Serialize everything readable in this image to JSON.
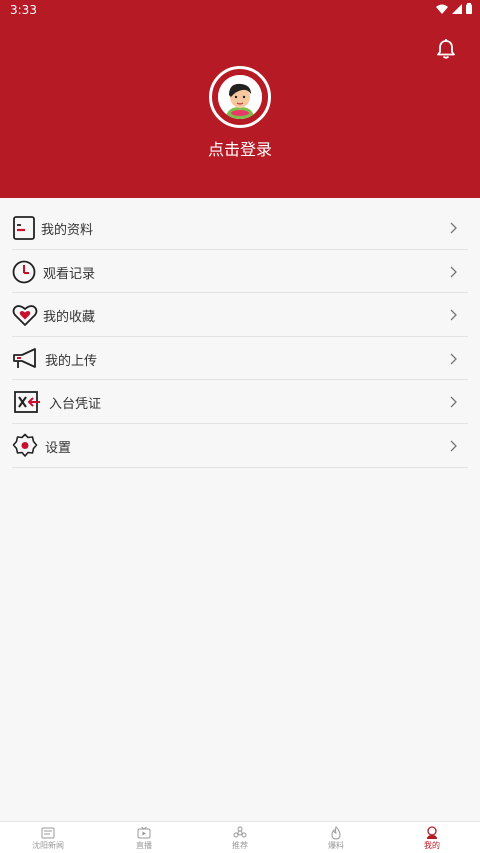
{
  "status_bar": {
    "time": "3:33"
  },
  "header": {
    "login_label": "点击登录",
    "bg_color": "#b61a24"
  },
  "menu": [
    {
      "label": "我的资料",
      "icon": "profile-card-icon"
    },
    {
      "label": "观看记录",
      "icon": "clock-icon"
    },
    {
      "label": "我的收藏",
      "icon": "heart-icon"
    },
    {
      "label": "我的上传",
      "icon": "megaphone-icon"
    },
    {
      "label": "入台凭证",
      "icon": "credential-icon"
    },
    {
      "label": "设置",
      "icon": "gear-icon"
    }
  ],
  "tabbar": [
    {
      "label": "沈阳新闻",
      "icon": "news-icon"
    },
    {
      "label": "直播",
      "icon": "tv-icon"
    },
    {
      "label": "推荐",
      "icon": "recommend-icon"
    },
    {
      "label": "爆料",
      "icon": "report-icon"
    },
    {
      "label": "我的",
      "icon": "me-icon",
      "active": true
    }
  ]
}
